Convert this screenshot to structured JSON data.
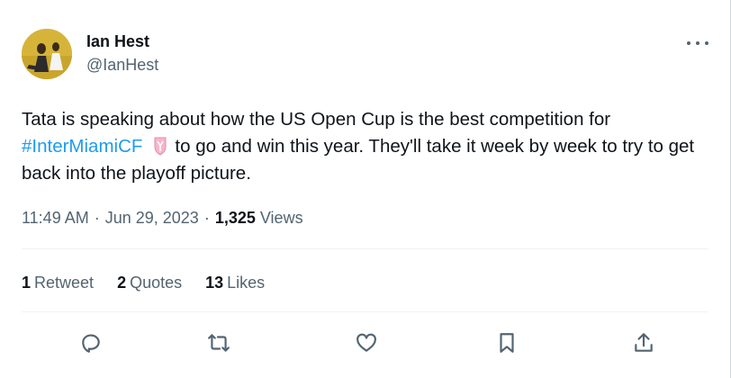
{
  "user": {
    "name": "Ian Hest",
    "handle": "@IanHest"
  },
  "tweet": {
    "text_before": "Tata is speaking about how the US Open Cup is the best competition for",
    "hashtag": "#InterMiamiCF",
    "text_after": "to go and win this year. They'll take it week by week to try to get back into the playoff picture."
  },
  "meta": {
    "time": "11:49 AM",
    "separator": "·",
    "date": "Jun 29, 2023",
    "views_count": "1,325",
    "views_label": "Views"
  },
  "stats": {
    "retweets_count": "1",
    "retweets_label": "Retweet",
    "quotes_count": "2",
    "quotes_label": "Quotes",
    "likes_count": "13",
    "likes_label": "Likes"
  },
  "icons": {
    "more": "more-horizontal-icon",
    "reply": "reply-icon",
    "retweet": "retweet-icon",
    "like": "heart-icon",
    "bookmark": "bookmark-icon",
    "share": "share-icon",
    "hashtag_emoji": "inter-miami-crest-icon"
  },
  "colors": {
    "link": "#1d9bf0",
    "text": "#0f1419",
    "secondary": "#536471",
    "divider": "#eff3f4"
  }
}
